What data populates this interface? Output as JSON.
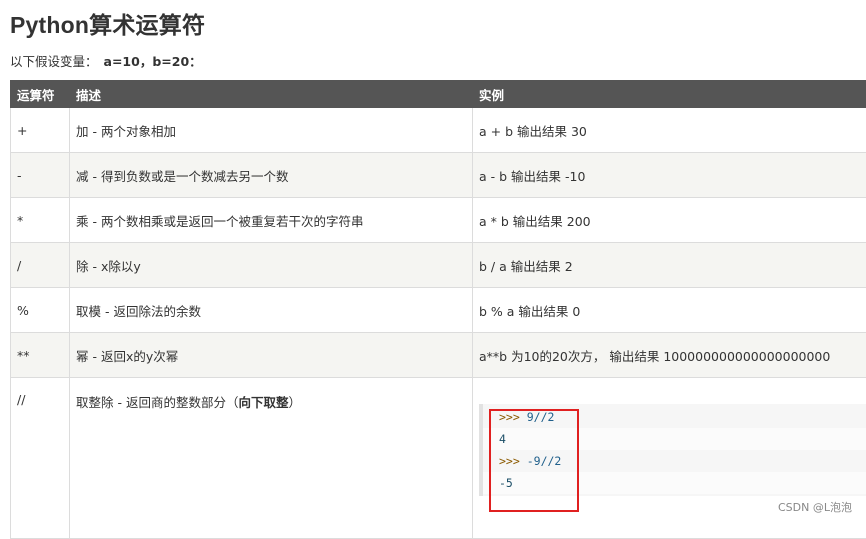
{
  "page": {
    "title": "Python算术运算符",
    "intro_text": "以下假设变量：",
    "intro_vars": "a=10，b=20："
  },
  "table": {
    "headers": [
      "运算符",
      "描述",
      "实例"
    ],
    "rows": [
      {
        "op": "+",
        "desc": "加 - 两个对象相加",
        "example": "a + b 输出结果 30"
      },
      {
        "op": "-",
        "desc": "减 - 得到负数或是一个数减去另一个数",
        "example": "a - b 输出结果 -10"
      },
      {
        "op": "*",
        "desc": "乘 - 两个数相乘或是返回一个被重复若干次的字符串",
        "example": "a * b 输出结果 200"
      },
      {
        "op": "/",
        "desc": "除 - x除以y",
        "example": "b / a 输出结果 2"
      },
      {
        "op": "%",
        "desc": "取模 - 返回除法的余数",
        "example": "b % a 输出结果 0"
      },
      {
        "op": "**",
        "desc": "幂 - 返回x的y次幂",
        "example": "a**b 为10的20次方， 输出结果 100000000000000000000"
      }
    ],
    "floor_row": {
      "op": "//",
      "desc": "取整除 - 返回商的整数部分（",
      "desc_bold": "向下取整",
      "desc_end": "）"
    }
  },
  "code": {
    "prompt": ">>>",
    "line1_expr": "9//2",
    "line2_out": "4",
    "line3_expr": "-9//2",
    "line4_out": "-5"
  },
  "watermark": "CSDN @L泡泡",
  "colors": {
    "header_bg": "#555555",
    "alt_row": "#f5f5f2",
    "highlight_box": "#e02020"
  }
}
